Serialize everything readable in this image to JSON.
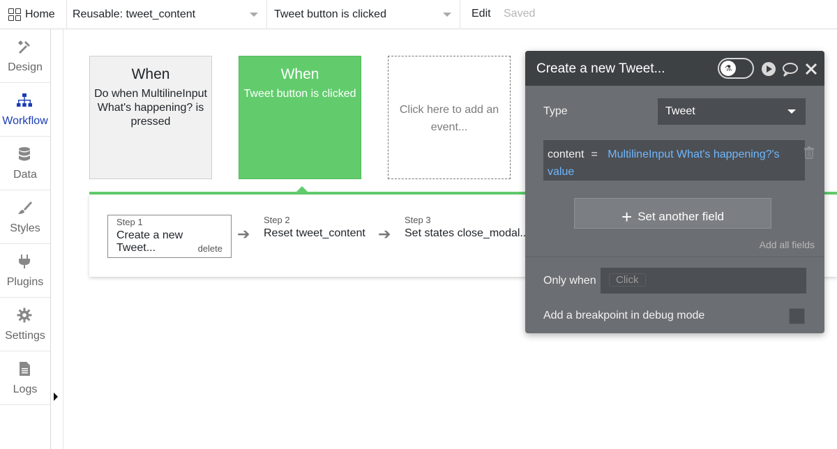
{
  "topbar": {
    "home_label": "Home",
    "page_selector": "Reusable: tweet_content",
    "event_selector": "Tweet button is clicked",
    "edit_label": "Edit",
    "saved_label": "Saved"
  },
  "sidebar": {
    "items": [
      {
        "label": "Design",
        "icon": "design-icon"
      },
      {
        "label": "Workflow",
        "icon": "workflow-icon"
      },
      {
        "label": "Data",
        "icon": "database-icon"
      },
      {
        "label": "Styles",
        "icon": "brush-icon"
      },
      {
        "label": "Plugins",
        "icon": "plug-icon"
      },
      {
        "label": "Settings",
        "icon": "gear-icon"
      },
      {
        "label": "Logs",
        "icon": "document-icon"
      }
    ],
    "active": "Workflow",
    "active_color": "#1a3cb5"
  },
  "events": [
    {
      "title": "When",
      "subtitle": "Do when MultilineInput What's happening? is pressed"
    },
    {
      "title": "When",
      "subtitle": "Tweet button is clicked"
    },
    {
      "title": "",
      "subtitle": "Click here to add an event..."
    }
  ],
  "steps": [
    {
      "number": "Step 1",
      "name": "Create a new Tweet...",
      "delete": "delete"
    },
    {
      "number": "Step 2",
      "name": "Reset tweet_content"
    },
    {
      "number": "Step 3",
      "name": "Set states close_modal..."
    }
  ],
  "popup": {
    "title": "Create a new Tweet...",
    "type_label": "Type",
    "type_value": "Tweet",
    "field_name": "content",
    "field_eq": "=",
    "field_value_line1": "MultilineInput What's happening?'s",
    "field_value_line2": "value",
    "set_another_field": "Set another field",
    "add_all_fields": "Add all fields",
    "only_when_label": "Only when",
    "only_when_placeholder": "Click",
    "breakpoint_label": "Add a breakpoint in debug mode"
  },
  "colors": {
    "accent_green": "#62cc6d",
    "popup_bg": "#6b6e72",
    "dynamic_text": "#6fb7ff"
  }
}
